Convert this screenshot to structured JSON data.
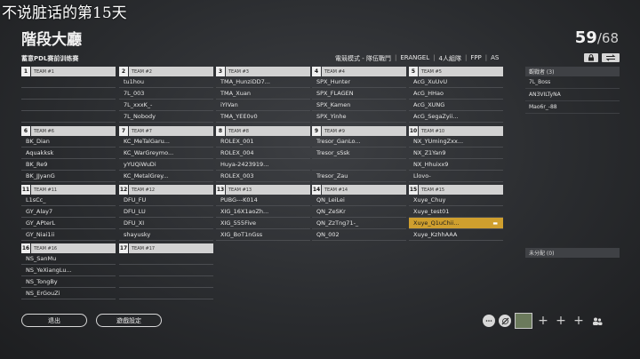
{
  "overlay_title": "不说脏话的第15天",
  "page_title": "階段大廳",
  "player_count": {
    "current": "59",
    "max": "68"
  },
  "room_name": "蓄意PDL赛前训练赛",
  "game_settings": {
    "mode": "電競模式 - 隊伍戰鬥",
    "map": "ERANGEL",
    "squad": "4人組隊",
    "perspective": "FPP",
    "region": "AS"
  },
  "teams": [
    {
      "num": "1",
      "label": "TEAM #1",
      "players": [
        "",
        "",
        "",
        ""
      ]
    },
    {
      "num": "2",
      "label": "TEAM #2",
      "players": [
        "tu1hou",
        "7L_003",
        "7L_xxxK_-",
        "7L_Nobody"
      ]
    },
    {
      "num": "3",
      "label": "TEAM #3",
      "players": [
        "TMA_HunziDD7...",
        "TMA_Xuan",
        "iYIVan",
        "TMA_YEE0v0"
      ]
    },
    {
      "num": "4",
      "label": "TEAM #4",
      "players": [
        "SPX_Hunter",
        "SPX_FLAGEN",
        "SPX_Kamen",
        "SPX_Yinhe"
      ]
    },
    {
      "num": "5",
      "label": "TEAM #5",
      "players": [
        "AcG_XuUvU",
        "AcG_HHao",
        "AcG_XUNG",
        "AcG_SegaZyii..."
      ]
    },
    {
      "num": "6",
      "label": "TEAM #6",
      "players": [
        "BK_Dian",
        "Aquakksk",
        "BK_Re9",
        "BK_JJyanG"
      ]
    },
    {
      "num": "7",
      "label": "TEAM #7",
      "players": [
        "KC_MeTalGaru...",
        "KC_WarGreymo...",
        "yYUQiWuDi",
        "KC_MetalGrey..."
      ]
    },
    {
      "num": "8",
      "label": "TEAM #8",
      "players": [
        "ROLEX_001",
        "ROLEX_004",
        "Huya-2423919...",
        "ROLEX_003"
      ]
    },
    {
      "num": "9",
      "label": "TEAM #9",
      "players": [
        "Tresor_GanLo...",
        "Tresor_sSsk",
        "",
        "Tresor_Zau"
      ]
    },
    {
      "num": "10",
      "label": "TEAM #10",
      "players": [
        "NX_YUmingZxx...",
        "NX_Z1Yan9",
        "NX_Hhuixx9",
        "Llovo-"
      ]
    },
    {
      "num": "11",
      "label": "TEAM #11",
      "players": [
        "L1sCc_",
        "GY_Alay7",
        "GY_APterL",
        "GY_Niai1ii"
      ]
    },
    {
      "num": "12",
      "label": "TEAM #12",
      "players": [
        "DFU_FU",
        "DFU_LU",
        "DFU_XI",
        "shayusky"
      ]
    },
    {
      "num": "13",
      "label": "TEAM #13",
      "players": [
        "PUBG---K014",
        "XIG_16X1aoZh...",
        "XIG_555Five",
        "XIG_BoT1nGss"
      ]
    },
    {
      "num": "14",
      "label": "TEAM #14",
      "players": [
        "QN_LeiLei",
        "QN_ZeSKr",
        "QN_ZzTng71-_",
        "QN_002"
      ]
    },
    {
      "num": "15",
      "label": "TEAM #15",
      "players": [
        "Xuye_Chuy",
        "Xuye_test01",
        "Xuye_Q1uChii...",
        "Xuye_KzhhAAA"
      ]
    },
    {
      "num": "16",
      "label": "TEAM #16",
      "players": [
        "NS_SanMu",
        "NS_YeXiangLu...",
        "NS_TongBy",
        "NS_ErGouZi"
      ]
    },
    {
      "num": "17",
      "label": "TEAM #17",
      "players": [
        "",
        "",
        "",
        ""
      ]
    }
  ],
  "spectators": {
    "header": "觀戰者 (3)",
    "items": [
      "7L_Boss",
      "AN3VILTyNA",
      "Mao6r_-88"
    ]
  },
  "unassigned": {
    "header": "未分配 (0)"
  },
  "buttons": {
    "exit": "退出",
    "settings": "遊戲設定"
  },
  "icons": {
    "lock": "lock-icon",
    "swap": "swap-icon",
    "mic": "mic-icon"
  },
  "colors": {
    "highlight": "#cf9f2e",
    "header_bg": "#d2d2d2"
  }
}
